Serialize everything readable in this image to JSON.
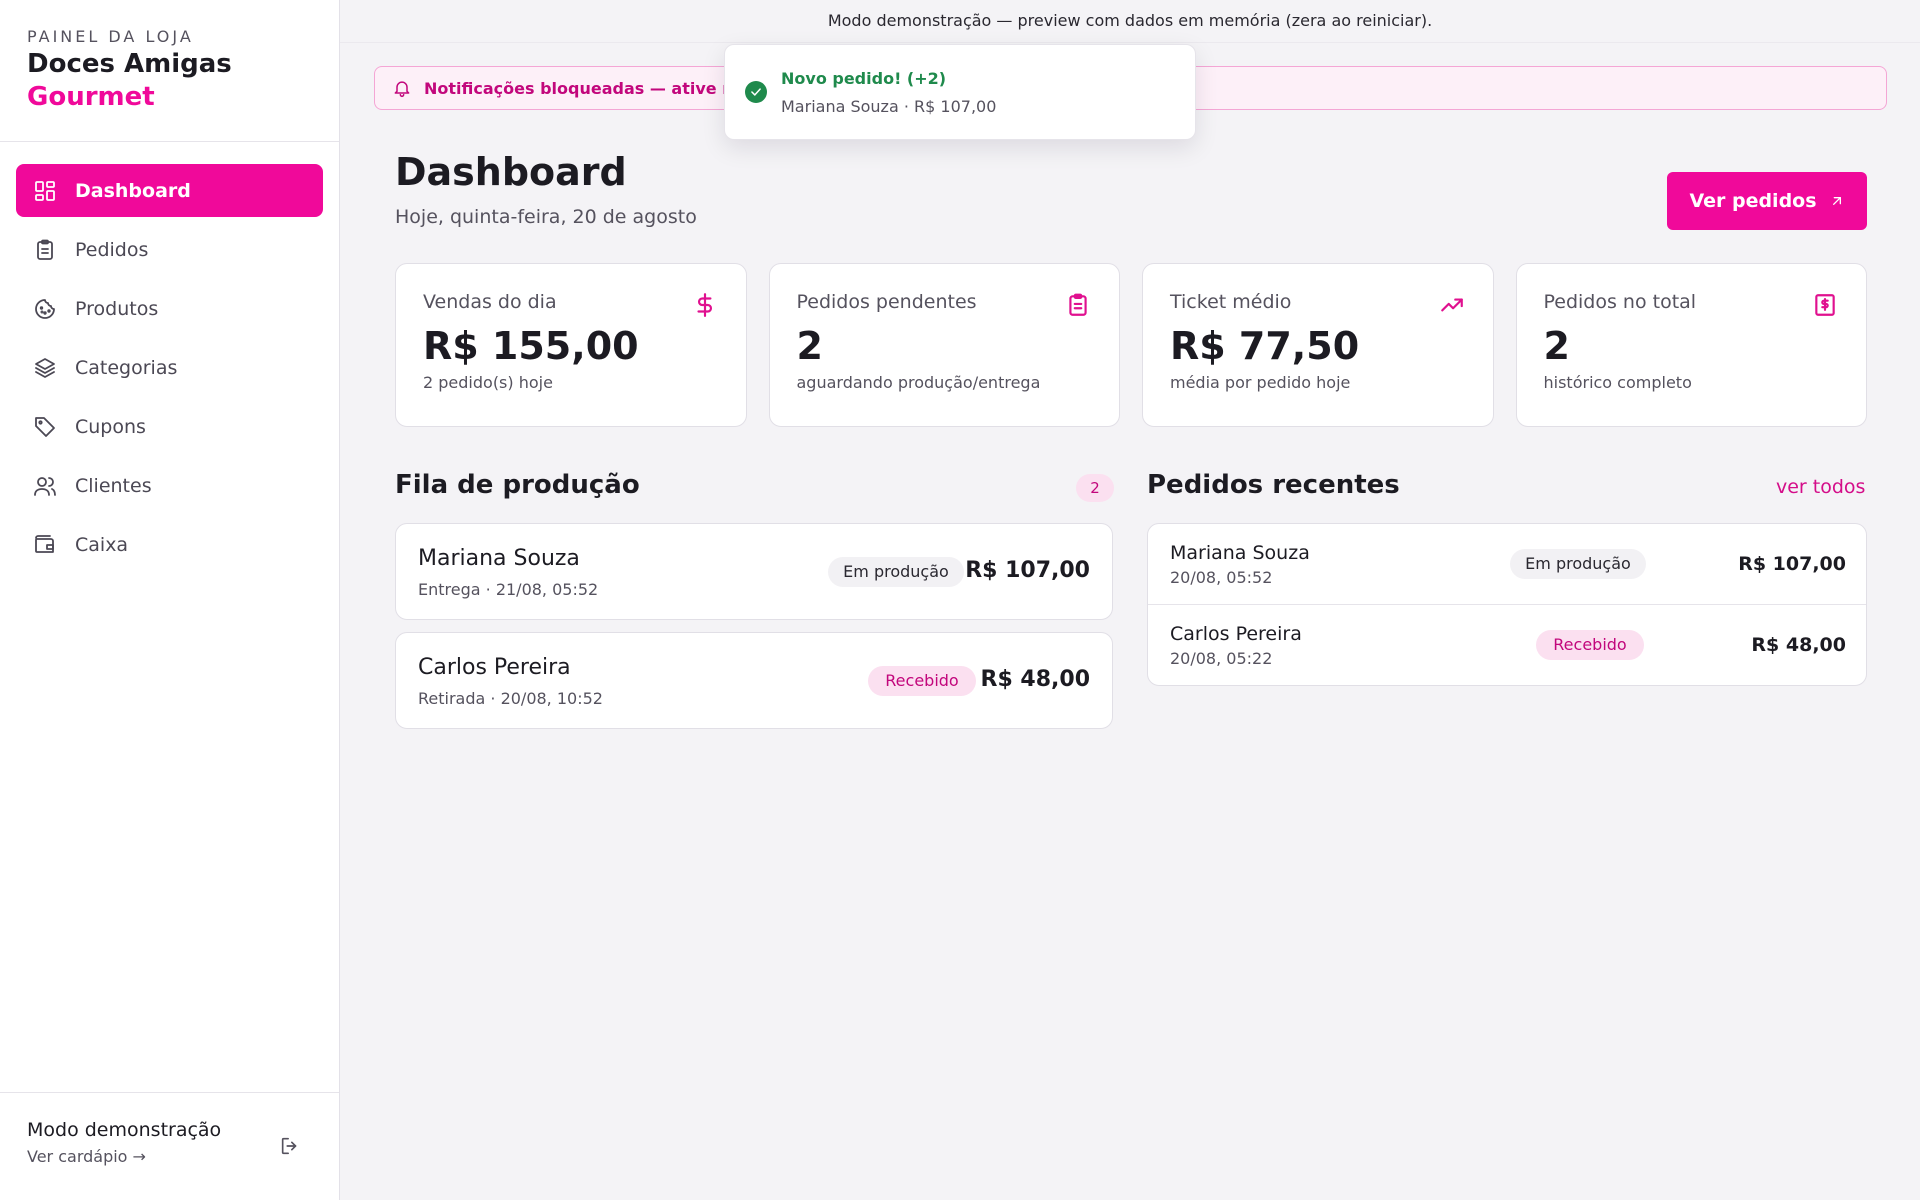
{
  "colors": {
    "accent": "#f0099a",
    "success": "#1f8a4c",
    "pill_received_bg": "#fbe0f0"
  },
  "sidebar": {
    "kicker": "PAINEL DA LOJA",
    "store_name": "Doces Amigas",
    "store_accent": "Gourmet",
    "items": [
      {
        "label": "Dashboard",
        "icon": "dashboard-grid-icon",
        "active": true
      },
      {
        "label": "Pedidos",
        "icon": "clipboard-icon"
      },
      {
        "label": "Produtos",
        "icon": "cookie-icon"
      },
      {
        "label": "Categorias",
        "icon": "layers-icon"
      },
      {
        "label": "Cupons",
        "icon": "tag-icon"
      },
      {
        "label": "Clientes",
        "icon": "users-icon"
      },
      {
        "label": "Caixa",
        "icon": "wallet-icon"
      }
    ],
    "footer": {
      "title": "Modo demonstração",
      "link": "Ver cardápio →",
      "logout_icon": "logout-icon"
    }
  },
  "demo_bar": "Modo demonstração — preview com dados em memória (zera ao reiniciar).",
  "notification_banner": "Notificações bloqueadas — ative nas",
  "toast": {
    "title": "Novo pedido! (+2)",
    "subtitle": "Mariana Souza · R$ 107,00"
  },
  "header": {
    "title": "Dashboard",
    "date": "Hoje, quinta-feira, 20 de agosto",
    "button": "Ver pedidos"
  },
  "stats": [
    {
      "label": "Vendas do dia",
      "value": "R$ 155,00",
      "sub": "2 pedido(s) hoje",
      "icon": "dollar-icon"
    },
    {
      "label": "Pedidos pendentes",
      "value": "2",
      "sub": "aguardando produção/entrega",
      "icon": "clipboard-list-icon"
    },
    {
      "label": "Ticket médio",
      "value": "R$ 77,50",
      "sub": "média por pedido hoje",
      "icon": "trending-up-icon"
    },
    {
      "label": "Pedidos no total",
      "value": "2",
      "sub": "histórico completo",
      "icon": "receipt-icon"
    }
  ],
  "queue": {
    "title": "Fila de produção",
    "count": "2",
    "items": [
      {
        "name": "Mariana Souza",
        "meta": "Entrega · 21/08, 05:52",
        "status": "Em produção",
        "price": "R$ 107,00"
      },
      {
        "name": "Carlos Pereira",
        "meta": "Retirada · 20/08, 10:52",
        "status": "Recebido",
        "price": "R$ 48,00"
      }
    ]
  },
  "recent": {
    "title": "Pedidos recentes",
    "link": "ver todos",
    "items": [
      {
        "name": "Mariana Souza",
        "date": "20/08, 05:52",
        "status": "Em produção",
        "price": "R$ 107,00"
      },
      {
        "name": "Carlos Pereira",
        "date": "20/08, 05:22",
        "status": "Recebido",
        "price": "R$ 48,00"
      }
    ]
  }
}
